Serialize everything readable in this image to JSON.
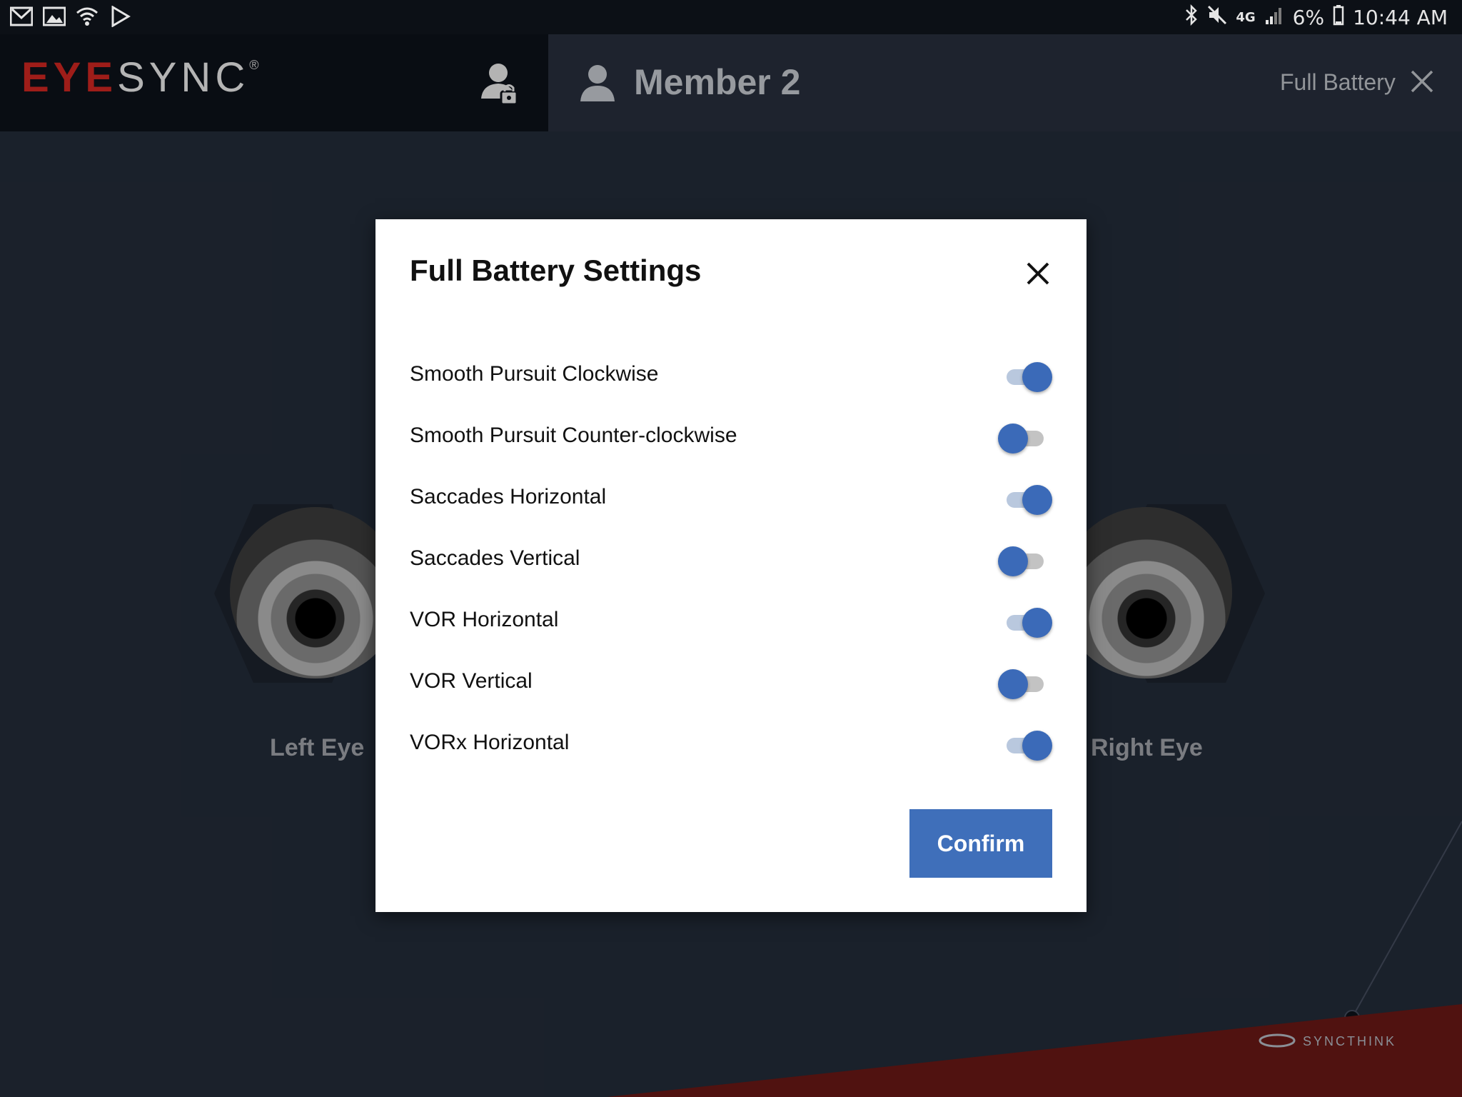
{
  "status_bar": {
    "battery_percent": "6%",
    "time": "10:44 AM",
    "network": "4G",
    "left_icons": [
      "gmail-icon",
      "gallery-icon",
      "wifi-icon",
      "play-store-icon"
    ],
    "right_icons": [
      "bluetooth-icon",
      "mute-icon",
      "signal-icon",
      "battery-icon"
    ]
  },
  "app": {
    "logo_eye": "EYE",
    "logo_sync": "SYNC",
    "logo_mark": "®",
    "member_name": "Member 2",
    "test_name": "Full Battery"
  },
  "eyes": {
    "left_label": "Left Eye",
    "right_label": "Right Eye"
  },
  "footer": {
    "brand": "SYNCTHINK"
  },
  "modal": {
    "title": "Full Battery Settings",
    "settings": [
      {
        "label": "Smooth Pursuit Clockwise",
        "enabled": true
      },
      {
        "label": "Smooth Pursuit Counter-clockwise",
        "enabled": false
      },
      {
        "label": "Saccades Horizontal",
        "enabled": true
      },
      {
        "label": "Saccades Vertical",
        "enabled": false
      },
      {
        "label": "VOR Horizontal",
        "enabled": true
      },
      {
        "label": "VOR Vertical",
        "enabled": false
      },
      {
        "label": "VORx Horizontal",
        "enabled": true
      }
    ],
    "confirm_label": "Confirm"
  },
  "colors": {
    "accent": "#3f6fba",
    "brand_red": "#b0211c",
    "background": "#1e2530"
  }
}
